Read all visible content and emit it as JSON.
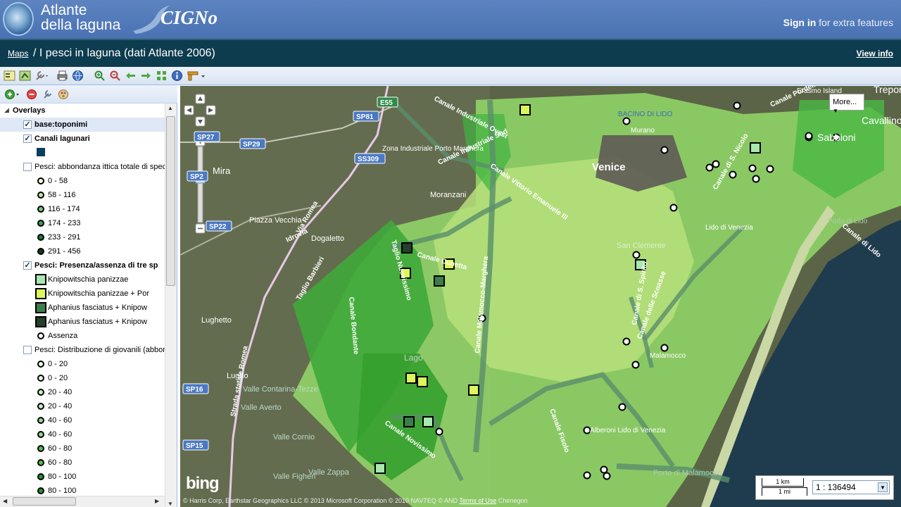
{
  "header": {
    "brand_line1": "Atlante",
    "brand_line2": "della laguna",
    "product": "CIGNo",
    "signin_bold": "Sign in",
    "signin_rest": " for extra features"
  },
  "titlebar": {
    "maps_link": "Maps",
    "title": "/ I pesci in laguna (dati Atlante 2006)",
    "view_info": "View info"
  },
  "panel": {
    "root": "Overlays",
    "layers": [
      {
        "label": "base:toponimi",
        "checked": true,
        "bold": true
      },
      {
        "label": "Canali lagunari",
        "checked": true,
        "bold": true
      },
      {
        "label": "Pesci: abbondanza ittica totale di spec",
        "checked": false,
        "bold": false
      },
      {
        "label": "Pesci: Presenza/assenza di tre sp",
        "checked": true,
        "bold": true
      },
      {
        "label": "Pesci: Distribuzione di giovanili (abbond",
        "checked": false,
        "bold": false
      }
    ],
    "abundance_classes": [
      "0 - 58",
      "58 - 116",
      "116 - 174",
      "174 - 233",
      "233 - 291",
      "291 - 456"
    ],
    "abundance_colors": [
      "#ffffcc",
      "#c2e699",
      "#78c679",
      "#31a354",
      "#1a7a3a",
      "#0b3d1e"
    ],
    "presence_classes": [
      "Knipowitschia panizzae",
      "Knipowitschia panizzae + Por",
      "Aphanius fasciatus + Knipow",
      "Aphanius fasciatus + Knipow",
      "Assenza"
    ],
    "presence_colors": [
      "#a8e8b0",
      "#dcf75a",
      "#3c7d4a",
      "#24402a",
      "#ffffff"
    ],
    "juvenile_classes": [
      "0 - 20",
      "0 - 20",
      "20 - 40",
      "20 - 40",
      "40 - 60",
      "40 - 60",
      "60 - 80",
      "60 - 80",
      "80 - 100",
      "80 - 100"
    ],
    "juvenile_colors": [
      "#e9fbe4",
      "#e9fbe4",
      "#c6efc0",
      "#c6efc0",
      "#8fd987",
      "#8fd987",
      "#4fbf4f",
      "#4fbf4f",
      "#1f9a2f",
      "#1f9a2f"
    ]
  },
  "map": {
    "more_button": "More...",
    "scale_km": "1 km",
    "scale_mi": "1 mi",
    "scale_value": "1 : 136494",
    "logo": "bing",
    "attribution_prefix": "© Harris Corp, Earthstar Geographics LLC © 2013 Microsoft Corporation © 2010 NAVTEQ © AND ",
    "terms": "Terms of Use",
    "attribution_suffix": " Chenegon",
    "place_labels": [
      "Venice",
      "Mira",
      "Piazza Vecchia",
      "Dogaletto",
      "Moranzani",
      "Lughetto",
      "Lugho",
      "Lido di Venezia",
      "San Clemente",
      "Malamocco",
      "Alberoni Lido di Venezia",
      "Cavallino-",
      "Treporti",
      "Sabbioni",
      "Erasmo Island",
      "Murano",
      "Zona Industriale Porto Marghera",
      "BACINO DI LIDO",
      "Valle Contarina-Tezze",
      "Valle Averto",
      "Valle Cornio",
      "Valle Zappa",
      "Valle Figheri",
      "Porto di Lido",
      "Porto di Malamocco",
      "Lago"
    ],
    "road_labels": [
      "SP81",
      "SP29",
      "SS309",
      "SP22",
      "E55",
      "SP16",
      "SP15",
      "SP27",
      "SP2",
      "Via Romea",
      "Idrovia",
      "Canale Cunetta",
      "Canale Vittorio Emanuele III",
      "Canale Industriale Sud",
      "Canale Industriale Ovest",
      "Canale Malamocco-Marghera",
      "Canale delle Scoasse",
      "Canale di S. Spirito",
      "Canale Fisolo",
      "Canale Novissimo",
      "Canale di S. Nicolo",
      "Canale Pordelio",
      "Taglio Barbieri",
      "Taglio Nuovissimo",
      "Canale Bondante",
      "Strada statale Romea",
      "Canale di Lido"
    ]
  }
}
